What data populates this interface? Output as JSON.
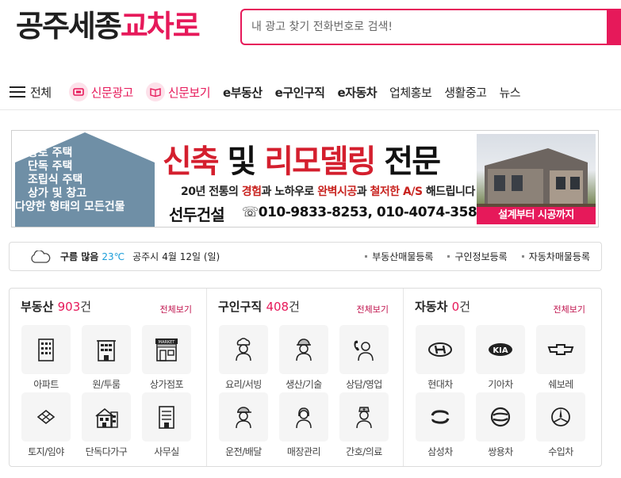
{
  "logo": {
    "part1": "공주세종",
    "part2": "교차로"
  },
  "search": {
    "placeholder": "내 광고 찾기 전화번호로 검색!"
  },
  "nav": {
    "all": "전체",
    "items": [
      "신문광고",
      "신문보기",
      "e부동산",
      "e구인구직",
      "e자동차",
      "업체홍보",
      "생활중고",
      "뉴스"
    ]
  },
  "banner": {
    "house_lines": [
      "황토 주택",
      "단독 주택",
      "조립식 주택",
      "상가 및 창고",
      "다양한 형태의 모든건물"
    ],
    "headline_red1": "신축",
    "headline_mid": " 및 ",
    "headline_red2": "리모델링",
    "headline_end": " 전문",
    "sub": {
      "p1": "20년 전통의 ",
      "p2": "경험",
      "p3": "과 노하우로 ",
      "p4": "완벽시공",
      "p5": "과 ",
      "p6": "철저한 A/S",
      "p7": " 해드립니다"
    },
    "company": "선두건설",
    "phone": "☏010-9833-8253, 010-4074-3582",
    "cta": "설계부터 시공까지"
  },
  "weather": {
    "icon": "cloud-icon",
    "condition": "구름 많음",
    "temp": "23℃",
    "location": "공주시",
    "date": "4월 12일 (일)",
    "links": [
      "부동산매물등록",
      "구인정보등록",
      "자동차매물등록"
    ]
  },
  "categories": [
    {
      "title": "부동산",
      "count": "903",
      "unit": "건",
      "more": "전체보기",
      "items": [
        "아파트",
        "원/투룸",
        "상가점포",
        "토지/임야",
        "단독다가구",
        "사무실"
      ]
    },
    {
      "title": "구인구직",
      "count": "408",
      "unit": "건",
      "more": "전체보기",
      "items": [
        "요리/서빙",
        "생산/기술",
        "상담/영업",
        "운전/배달",
        "매장관리",
        "간호/의료"
      ]
    },
    {
      "title": "자동차",
      "count": "0",
      "unit": "건",
      "more": "전체보기",
      "items": [
        "현대차",
        "기아차",
        "쉐보레",
        "삼성차",
        "쌍용차",
        "수입차"
      ]
    }
  ],
  "market_sign": "MARKET",
  "kia_mark": "KIA",
  "colors": {
    "accent": "#e6195a",
    "temp": "#1a9dd9",
    "banner_red": "#d41f2e"
  }
}
